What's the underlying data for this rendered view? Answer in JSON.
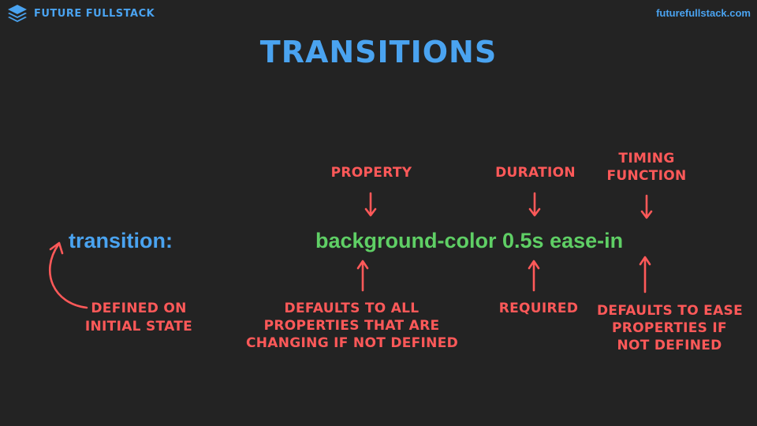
{
  "brand": {
    "name": "FUTURE FULLSTACK",
    "logo_icon": "layers-stack-icon"
  },
  "site_url": "futurefullstack.com",
  "title": "TRANSITIONS",
  "code": {
    "property": "transition:",
    "value": "background-color 0.5s ease-in"
  },
  "labels_top": {
    "property": "PROPERTY",
    "duration": "DURATION",
    "timing_function": [
      "TIMING",
      "FUNCTION"
    ]
  },
  "labels_bottom": {
    "defined_on": [
      "DEFINED ON",
      "INITIAL STATE"
    ],
    "defaults_all": [
      "DEFAULTS TO ALL",
      "PROPERTIES THAT ARE",
      "CHANGING IF NOT DEFINED"
    ],
    "required": "REQUIRED",
    "defaults_ease": [
      "DEFAULTS TO EASE",
      "PROPERTIES IF",
      "NOT DEFINED"
    ]
  },
  "colors": {
    "background": "#232323",
    "accent_blue": "#4aa3f0",
    "code_green": "#5fcf65",
    "annotation_red": "#ff5959"
  }
}
